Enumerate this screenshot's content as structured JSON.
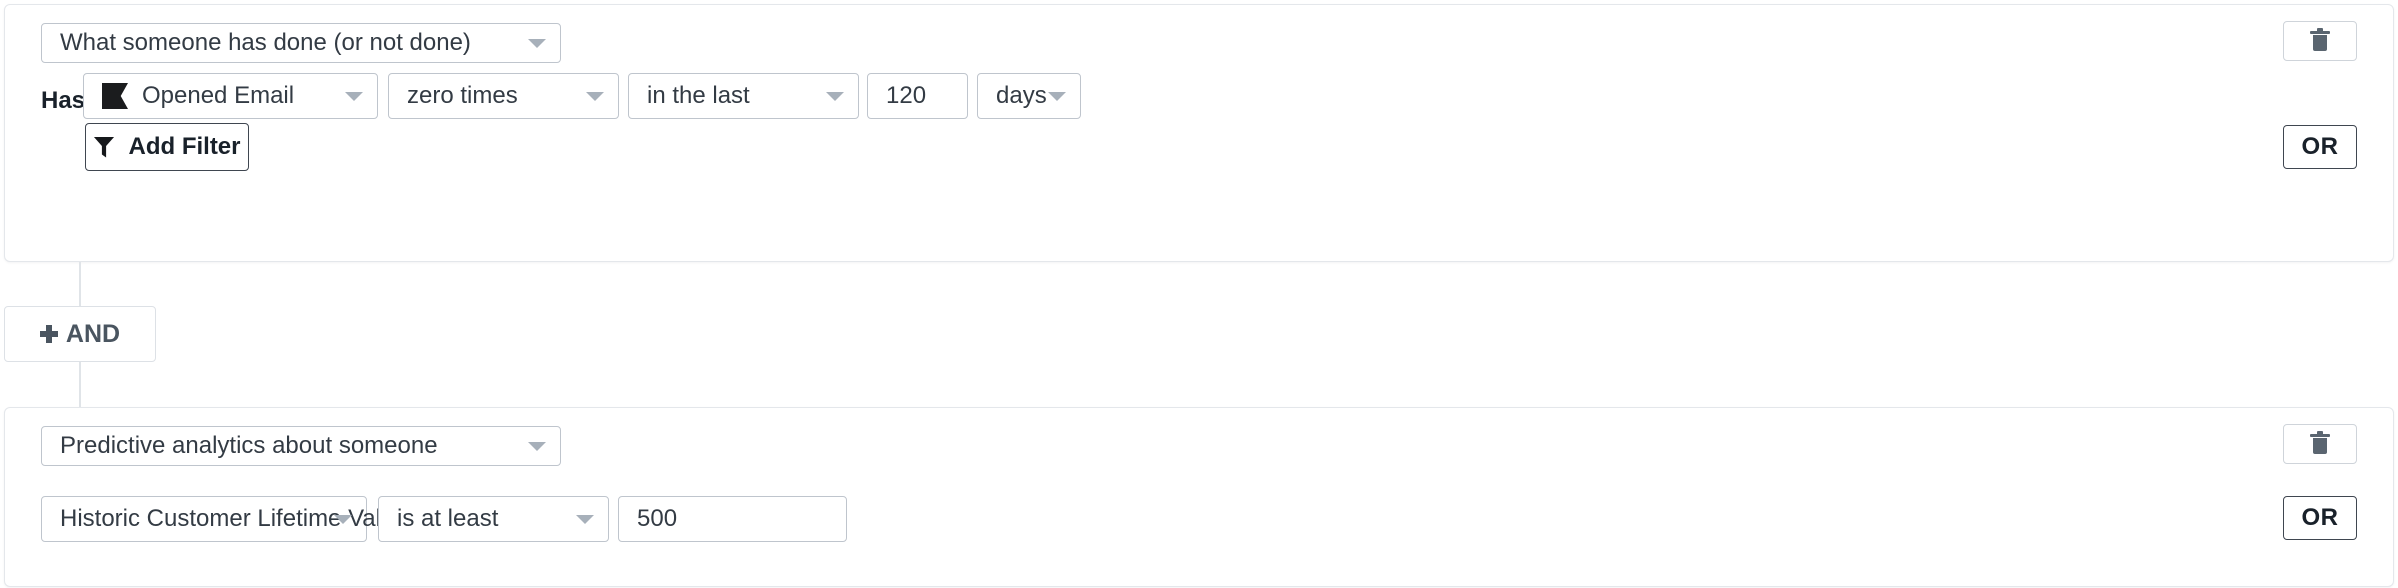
{
  "groups": [
    {
      "type_select": {
        "label": "What someone has done (or not done)",
        "caret": "chevron-down-icon"
      },
      "row_label": "Has",
      "filters": [
        {
          "kind": "metric",
          "mark": "klaviyo-flag-icon",
          "label": "Opened Email"
        },
        {
          "kind": "select",
          "label": "zero times"
        },
        {
          "kind": "select",
          "label": "in the last"
        },
        {
          "kind": "input",
          "value": "120"
        },
        {
          "kind": "select",
          "label": "days"
        }
      ],
      "add_filter": {
        "label": "Add Filter",
        "icon": "funnel-icon"
      },
      "or_label": "OR",
      "delete_icon": "trash-icon"
    },
    {
      "type_select": {
        "label": "Predictive analytics about someone",
        "caret": "chevron-down-icon"
      },
      "row_label": "",
      "filters": [
        {
          "kind": "select",
          "label": "Historic Customer Lifetime Value"
        },
        {
          "kind": "select",
          "label": "is at least"
        },
        {
          "kind": "input",
          "value": "500"
        }
      ],
      "or_label": "OR",
      "delete_icon": "trash-icon"
    }
  ],
  "connector": {
    "and_label": "AND",
    "plus_icon": "plus-icon"
  },
  "colors": {
    "border": "#bfc5cd",
    "card_border": "#e4e7eb",
    "caret": "#a7b0ba",
    "text": "#333b44",
    "strong_border": "#3f4650",
    "trash": "#5a6570",
    "mark": "#1b1c1e"
  }
}
